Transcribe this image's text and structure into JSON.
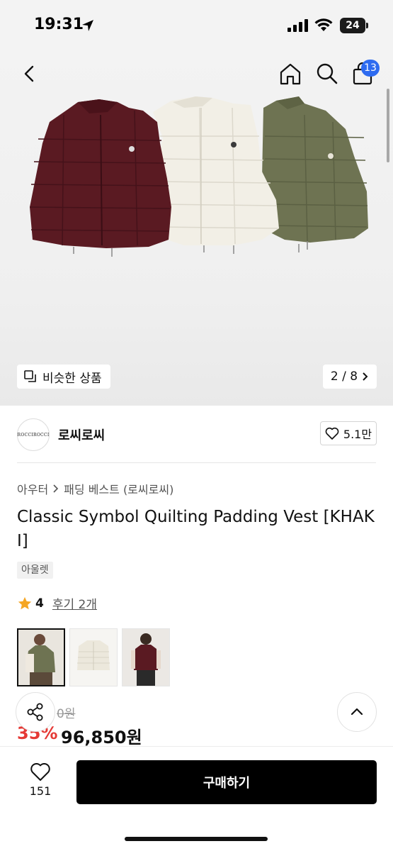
{
  "status": {
    "time": "19:31",
    "battery": "24"
  },
  "header": {
    "cart_count": "13"
  },
  "gallery": {
    "similar_label": "비슷한 상품",
    "counter": "2 / 8"
  },
  "shop": {
    "logo_text": "ROCCIROCCI",
    "name": "로씨로씨",
    "likes": "5.1만"
  },
  "breadcrumb": {
    "category": "아우터",
    "subcategory": "패딩 베스트 (로씨로씨)"
  },
  "product": {
    "title": "Classic Symbol Quilting Padding Vest [KHAKI]",
    "tag": "아울렛",
    "rating": "4",
    "reviews": "후기 2개",
    "original_price": "0원",
    "discount": "35%",
    "price": "96,850원"
  },
  "colors": {
    "burgundy": "#5a1a22",
    "ivory": "#f2efe6",
    "khaki": "#6e7352",
    "accent": "#2e6bf0",
    "discount": "#e53935",
    "star": "#f5a623"
  },
  "bottom": {
    "wish_count": "151",
    "buy_label": "구매하기"
  }
}
